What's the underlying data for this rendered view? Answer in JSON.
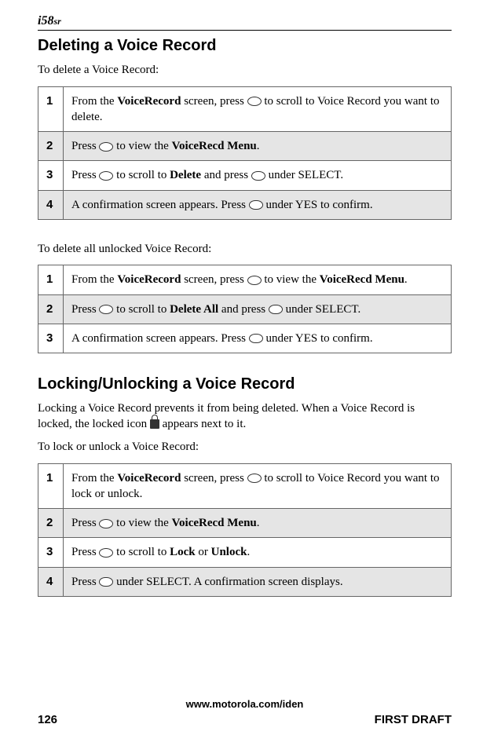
{
  "logo_model": "i58",
  "logo_suffix": "sr",
  "heading1": "Deleting a Voice Record",
  "intro1": "To delete a Voice Record:",
  "table1": {
    "rows": [
      {
        "num": "1",
        "parts": [
          "From the ",
          {
            "b": "VoiceRecord"
          },
          " screen, press ",
          {
            "glyph": "scroll"
          },
          " to scroll to Voice Record you want to delete."
        ]
      },
      {
        "num": "2",
        "parts": [
          "Press ",
          {
            "glyph": "menu"
          },
          " to view the ",
          {
            "b": "VoiceRecd Menu"
          },
          "."
        ]
      },
      {
        "num": "3",
        "parts": [
          "Press ",
          {
            "glyph": "scroll"
          },
          " to scroll to ",
          {
            "b": "Delete"
          },
          " and press ",
          {
            "glyph": "btn"
          },
          " under SELECT."
        ]
      },
      {
        "num": "4",
        "parts": [
          "A confirmation screen appears. Press ",
          {
            "glyph": "btn"
          },
          " under YES to confirm."
        ]
      }
    ]
  },
  "intro2": "To delete all unlocked Voice Record:",
  "table2": {
    "rows": [
      {
        "num": "1",
        "parts": [
          "From the ",
          {
            "b": "VoiceRecord"
          },
          " screen, press ",
          {
            "glyph": "menu"
          },
          " to view the ",
          {
            "b": "VoiceRecd Menu"
          },
          "."
        ]
      },
      {
        "num": "2",
        "parts": [
          "Press ",
          {
            "glyph": "scroll"
          },
          " to scroll to ",
          {
            "b": "Delete All"
          },
          " and press ",
          {
            "glyph": "btn"
          },
          " under SELECT."
        ]
      },
      {
        "num": "3",
        "parts": [
          "A confirmation screen appears. Press ",
          {
            "glyph": "btn"
          },
          " under YES to confirm."
        ]
      }
    ]
  },
  "heading2": "Locking/Unlocking a Voice Record",
  "lock_text_before": "Locking a Voice Record prevents it from being deleted. When a Voice Record is locked, the locked icon ",
  "lock_text_after": " appears next to it.",
  "intro3": "To lock or unlock a Voice Record:",
  "table3": {
    "rows": [
      {
        "num": "1",
        "parts": [
          "From the ",
          {
            "b": "VoiceRecord"
          },
          " screen, press ",
          {
            "glyph": "scroll"
          },
          " to scroll to Voice Record you want to lock or unlock."
        ]
      },
      {
        "num": "2",
        "parts": [
          "Press ",
          {
            "glyph": "menu"
          },
          " to view the ",
          {
            "b": "VoiceRecd Menu"
          },
          "."
        ]
      },
      {
        "num": "3",
        "parts": [
          "Press ",
          {
            "glyph": "scroll"
          },
          " to scroll to ",
          {
            "b": "Lock"
          },
          " or ",
          {
            "b": "Unlock"
          },
          "."
        ]
      },
      {
        "num": "4",
        "parts": [
          "Press ",
          {
            "glyph": "btn"
          },
          " under SELECT. A confirmation screen displays."
        ]
      }
    ]
  },
  "footer": {
    "url": "www.motorola.com/iden",
    "page": "126",
    "status": "FIRST DRAFT"
  }
}
